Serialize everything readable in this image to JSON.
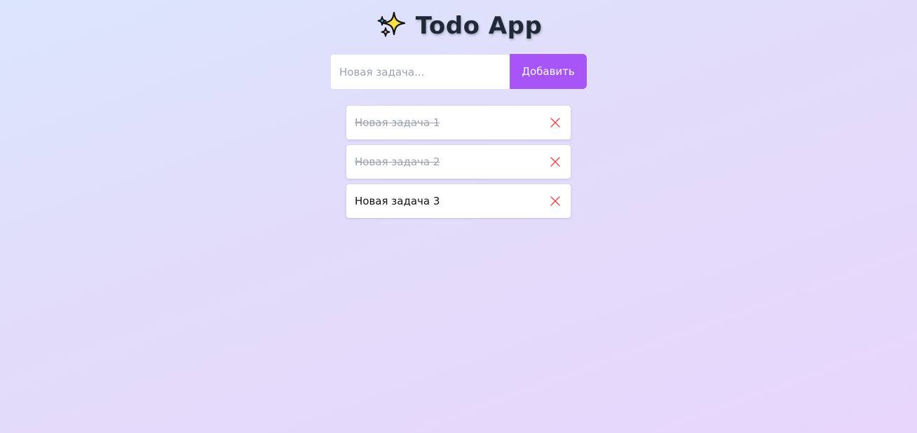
{
  "header": {
    "icon": "sparkles-icon",
    "title": "Todo App"
  },
  "form": {
    "placeholder": "Новая задача...",
    "value": "",
    "add_label": "Добавить"
  },
  "tasks": [
    {
      "text": "Новая задача 1",
      "done": true
    },
    {
      "text": "Новая задача 2",
      "done": true
    },
    {
      "text": "Новая задача 3",
      "done": false
    }
  ],
  "colors": {
    "accent": "#a855f7",
    "delete": "#ef4444",
    "done_text": "#9ca3af",
    "title": "#1f2937"
  }
}
